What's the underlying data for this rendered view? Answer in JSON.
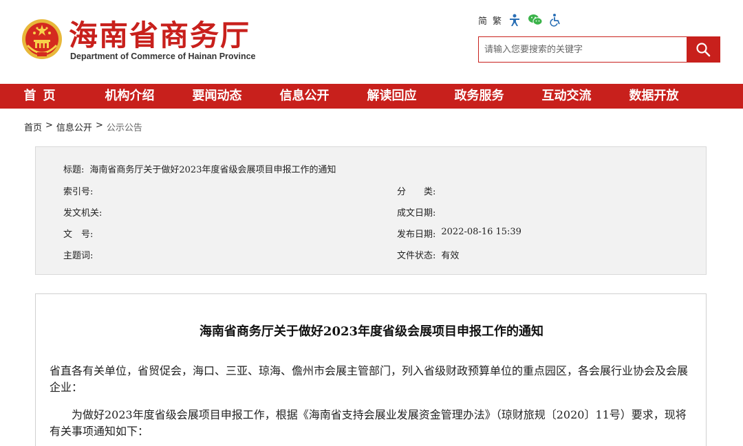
{
  "header": {
    "title": "海南省商务厅",
    "subtitle": "Department of Commerce of Hainan Province",
    "tools": {
      "simplified": "简",
      "traditional": "繁"
    },
    "icons": [
      "accessibility-person-icon",
      "wechat-icon",
      "wheelchair-icon",
      "search-icon"
    ],
    "search": {
      "placeholder": "请输入您要搜索的关键字"
    },
    "brand_color": "#c8201c"
  },
  "nav": {
    "items": [
      "首页",
      "机构介绍",
      "要闻动态",
      "信息公开",
      "解读回应",
      "政务服务",
      "互动交流",
      "数据开放"
    ]
  },
  "breadcrumb": {
    "home": "首页",
    "sep1": ">",
    "level1": "信息公开",
    "sep2": ">",
    "current": "公示公告"
  },
  "meta": {
    "title_label": "标题:",
    "title_value": "海南省商务厅关于做好2023年度省级会展项目申报工作的通知",
    "index_label": "索引号:",
    "index_value": "",
    "category_label": "分　　类:",
    "category_value": "",
    "issuer_label": "发文机关:",
    "issuer_value": "",
    "written_date_label": "成文日期:",
    "written_date_value": "",
    "doc_no_label": "文　号:",
    "doc_no_value": "",
    "publish_date_label": "发布日期:",
    "publish_date_value": "2022-08-16 15:39",
    "keywords_label": "主题词:",
    "keywords_value": "",
    "status_label": "文件状态:",
    "status_value": "有效"
  },
  "article": {
    "title": "海南省商务厅关于做好2023年度省级会展项目申报工作的通知",
    "paragraph1": "省直各有关单位，省贸促会，海口、三亚、琼海、儋州市会展主管部门，列入省级财政预算单位的重点园区，各会展行业协会及会展企业：",
    "paragraph2": "为做好2023年度省级会展项目申报工作，根据《海南省支持会展业发展资金管理办法》（琼财旅规〔2020〕11号）要求，现将有关事项通知如下："
  }
}
